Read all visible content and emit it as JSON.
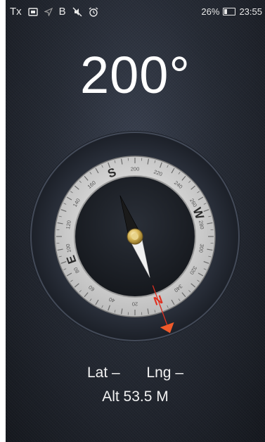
{
  "status_bar": {
    "left_icons": [
      "tx-icon",
      "sim-icon",
      "location-arrow-icon",
      "bluetooth-icon",
      "mute-icon",
      "alarm-icon"
    ],
    "left_glyphs": {
      "tx": "Tx",
      "bluetooth": "B"
    },
    "battery_percent": "26%",
    "battery_level": 0.26,
    "time": "23:55"
  },
  "compass": {
    "heading_display": "200°",
    "heading_degrees": 200,
    "cardinals": {
      "north": "N",
      "east": "E",
      "south": "S",
      "west": "W"
    },
    "degree_labels": [
      "20",
      "40",
      "60",
      "80",
      "100",
      "120",
      "140",
      "160",
      "200",
      "220",
      "240",
      "260",
      "280",
      "300",
      "320",
      "340"
    ],
    "colors": {
      "needle_north": "#f0f0f0",
      "needle_south": "#1a1a1a",
      "north_marker": "#e03020",
      "dial": "#d8d8d8"
    }
  },
  "location": {
    "lat_label": "Lat",
    "lat_value": "–",
    "lng_label": "Lng",
    "lng_value": "–",
    "altitude_text": "Alt 53.5 M"
  }
}
